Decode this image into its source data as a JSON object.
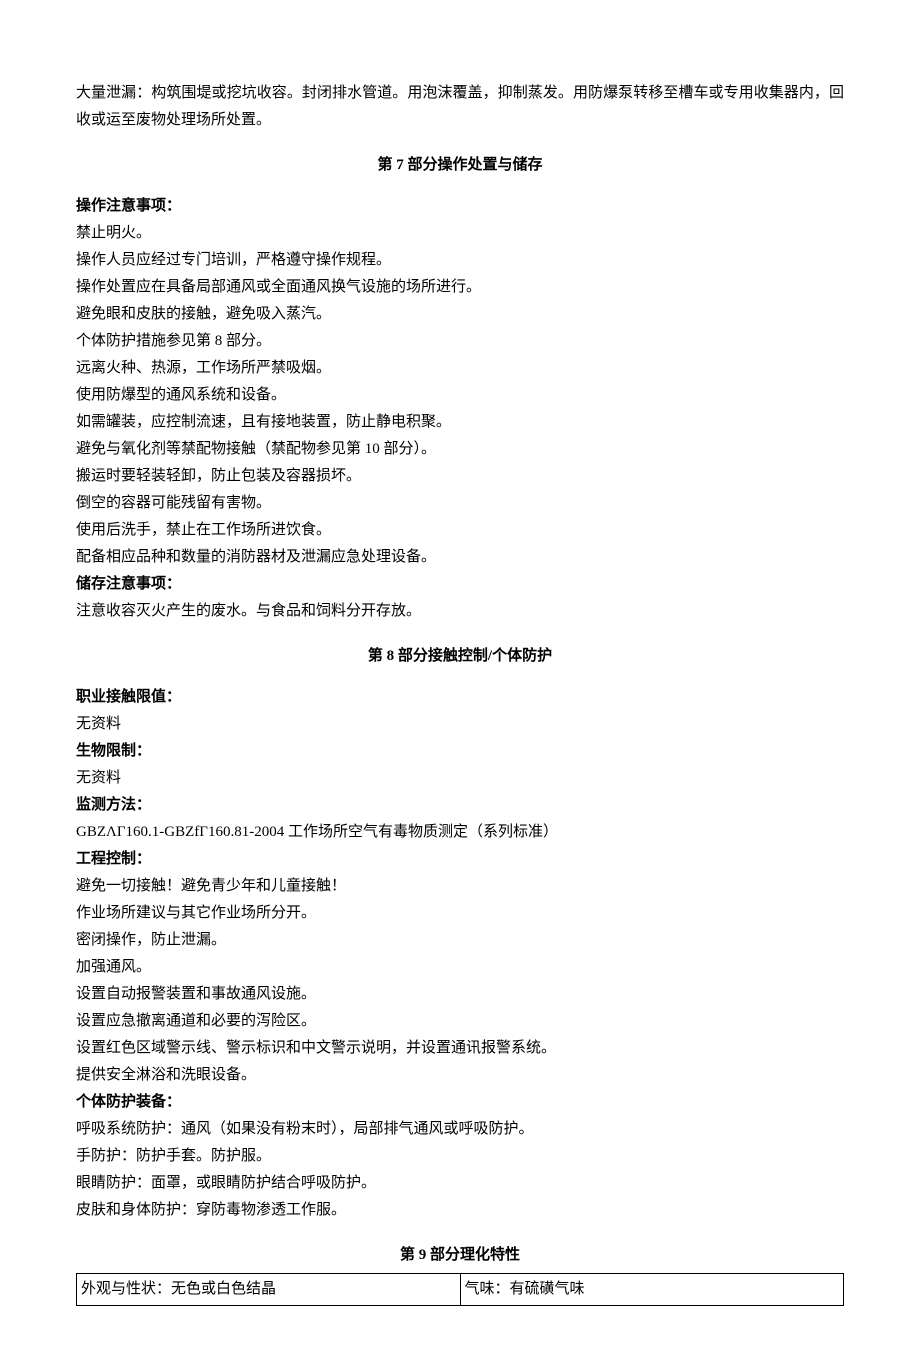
{
  "intro": {
    "p1": "大量泄漏：构筑围堤或挖坑收容。封闭排水管道。用泡沫覆盖，抑制蒸发。用防爆泵转移至槽车或专用收集器内，回收或运至废物处理场所处置。"
  },
  "section7": {
    "heading": "第 7 部分操作处置与储存",
    "op_label": "操作注意事项：",
    "op_lines": [
      "禁止明火。",
      "操作人员应经过专门培训，严格遵守操作规程。",
      "操作处置应在具备局部通风或全面通风换气设施的场所进行。",
      "避免眼和皮肤的接触，避免吸入蒸汽。",
      "个体防护措施参见第 8 部分。",
      "远离火种、热源，工作场所严禁吸烟。",
      "使用防爆型的通风系统和设备。",
      "如需罐装，应控制流速，且有接地装置，防止静电积聚。",
      "避免与氧化剂等禁配物接触（禁配物参见第 10 部分）。",
      "搬运时要轻装轻卸，防止包装及容器损坏。",
      "倒空的容器可能残留有害物。",
      "使用后洗手，禁止在工作场所进饮食。",
      "配备相应品种和数量的消防器材及泄漏应急处理设备。"
    ],
    "store_label": "储存注意事项：",
    "store_line": "注意收容灭火产生的废水。与食品和饲料分开存放。"
  },
  "section8": {
    "heading": "第 8 部分接触控制/个体防护",
    "occ_label": "职业接触限值：",
    "occ_value": "无资料",
    "bio_label": "生物限制：",
    "bio_value": "无资料",
    "monitor_label": "监测方法：",
    "monitor_value": "GBZΛΓ160.1-GBZfΓ160.81-2004 工作场所空气有毒物质测定（系列标准）",
    "eng_label": "工程控制：",
    "eng_lines": [
      "避免一切接触！避免青少年和儿童接触！",
      "作业场所建议与其它作业场所分开。",
      "密闭操作，防止泄漏。",
      "加强通风。",
      "设置自动报警装置和事故通风设施。",
      "设置应急撤离通道和必要的泻险区。",
      "设置红色区域警示线、警示标识和中文警示说明，并设置通讯报警系统。",
      "提供安全淋浴和洗眼设备。"
    ],
    "ppe_label": "个体防护装备：",
    "ppe_lines": [
      "呼吸系统防护：通风（如果没有粉末时），局部排气通风或呼吸防护。",
      "手防护：防护手套。防护服。",
      "眼睛防护：面罩，或眼睛防护结合呼吸防护。",
      "皮肤和身体防护：穿防毒物渗透工作服。"
    ]
  },
  "section9": {
    "heading": "第 9 部分理化特性",
    "row1_left": "外观与性状：无色或白色结晶",
    "row1_right": "气味：有硫磺气味"
  }
}
